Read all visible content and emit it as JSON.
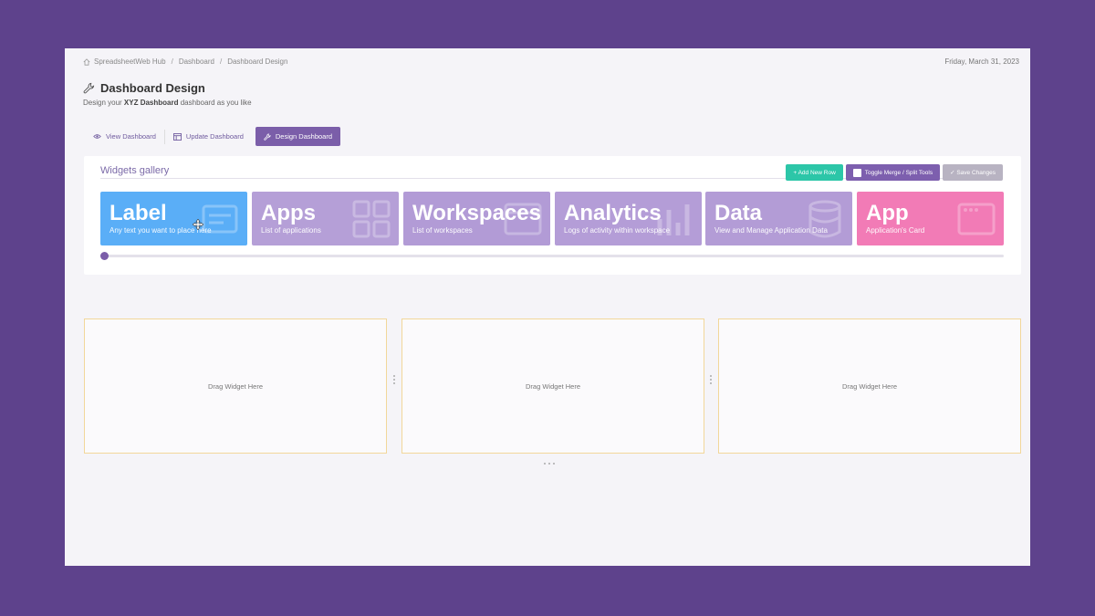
{
  "breadcrumb": {
    "home": "SpreadsheetWeb Hub",
    "items": [
      "Dashboard",
      "Dashboard Design"
    ]
  },
  "date": "Friday, March 31, 2023",
  "page": {
    "title": "Dashboard Design",
    "subtitle_pre": "Design your ",
    "subtitle_bold": "XYZ Dashboard",
    "subtitle_post": " dashboard as you like"
  },
  "tabs": [
    {
      "label": "View Dashboard",
      "icon": "eye-icon"
    },
    {
      "label": "Update Dashboard",
      "icon": "layout-icon"
    },
    {
      "label": "Design Dashboard",
      "icon": "wrench-icon",
      "active": true
    }
  ],
  "gallery": {
    "title": "Widgets gallery",
    "actions": {
      "add_row": "+ Add New Row",
      "toggle": "Toggle Merge / Split Tools",
      "save": "✓ Save Changes"
    },
    "cards": [
      {
        "name": "Label",
        "desc": "Any text you want to place here",
        "color": "#5aaef7"
      },
      {
        "name": "Apps",
        "desc": "List of applications",
        "color": "#b59fd7"
      },
      {
        "name": "Workspaces",
        "desc": "List of workspaces",
        "color": "#b29bd6"
      },
      {
        "name": "Analytics",
        "desc": "Logs of activity within workspace",
        "color": "#b49dd7"
      },
      {
        "name": "Data",
        "desc": "View and Manage Application Data",
        "color": "#b39cd6"
      },
      {
        "name": "App",
        "desc": "Application's Card",
        "color": "#f27bb6"
      }
    ]
  },
  "zones": [
    "Drag Widget Here",
    "Drag Widget Here",
    "Drag Widget Here"
  ],
  "colors": {
    "accent": "#7b5ea9",
    "green": "#2cc6a8",
    "background": "#5e428c"
  }
}
